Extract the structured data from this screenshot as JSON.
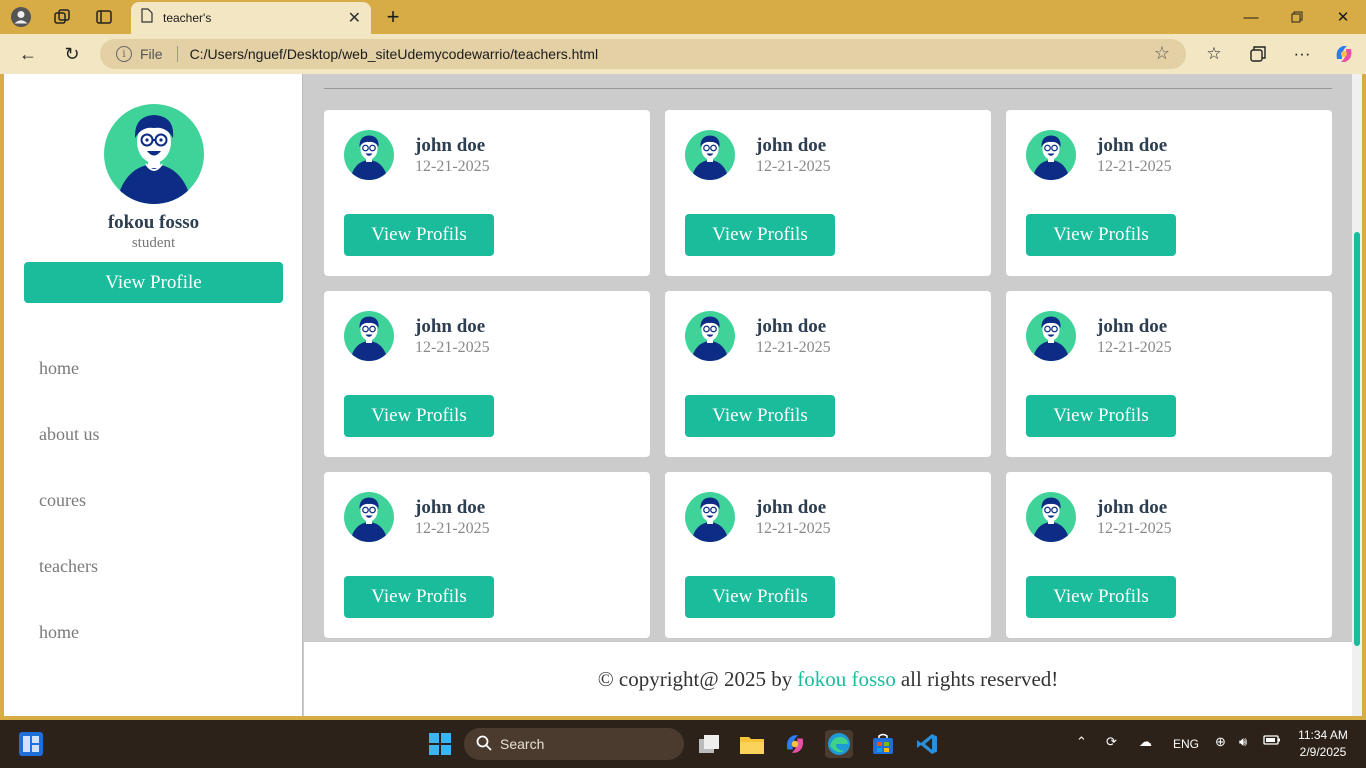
{
  "browser": {
    "tab_title": "teacher's",
    "url_prefix": "File",
    "url": "C:/Users/nguef/Desktop/web_siteUdemycodewarrio/teachers.html"
  },
  "sidebar": {
    "name": "fokou fosso",
    "role": "student",
    "profile_button": "View Profile",
    "nav": [
      {
        "label": "home"
      },
      {
        "label": "about us"
      },
      {
        "label": "coures"
      },
      {
        "label": "teachers"
      },
      {
        "label": "home"
      }
    ]
  },
  "teachers": [
    {
      "name": "john doe",
      "date": "12-21-2025",
      "button": "View Profils"
    },
    {
      "name": "john doe",
      "date": "12-21-2025",
      "button": "View Profils"
    },
    {
      "name": "john doe",
      "date": "12-21-2025",
      "button": "View Profils"
    },
    {
      "name": "john doe",
      "date": "12-21-2025",
      "button": "View Profils"
    },
    {
      "name": "john doe",
      "date": "12-21-2025",
      "button": "View Profils"
    },
    {
      "name": "john doe",
      "date": "12-21-2025",
      "button": "View Profils"
    },
    {
      "name": "john doe",
      "date": "12-21-2025",
      "button": "View Profils"
    },
    {
      "name": "john doe",
      "date": "12-21-2025",
      "button": "View Profils"
    },
    {
      "name": "john doe",
      "date": "12-21-2025",
      "button": "View Profils"
    }
  ],
  "footer": {
    "prefix": "© copyright@ 2025 by",
    "author": "fokou fosso",
    "suffix": "all rights reserved!"
  },
  "taskbar": {
    "search_placeholder": "Search",
    "language": "ENG",
    "time": "11:34 AM",
    "date": "2/9/2025"
  },
  "colors": {
    "accent": "#1abc9c",
    "browser_frame": "#d8ac44",
    "heading": "#2c3e50"
  },
  "icons": [
    "profile-icon",
    "workspaces-icon",
    "tab-actions-icon",
    "page-icon",
    "close-icon",
    "new-tab-icon",
    "minimize-icon",
    "restore-icon",
    "back-icon",
    "refresh-icon",
    "info-icon",
    "favorite-star-icon",
    "favorites-icon",
    "collections-icon",
    "more-icon",
    "copilot-icon",
    "widgets-icon",
    "windows-start-icon",
    "search-icon",
    "task-view-icon",
    "file-explorer-icon",
    "copilot-app-icon",
    "edge-icon",
    "store-icon",
    "vscode-icon",
    "chevron-up-icon",
    "sync-icon",
    "onedrive-icon",
    "network-icon",
    "volume-icon",
    "battery-icon"
  ]
}
